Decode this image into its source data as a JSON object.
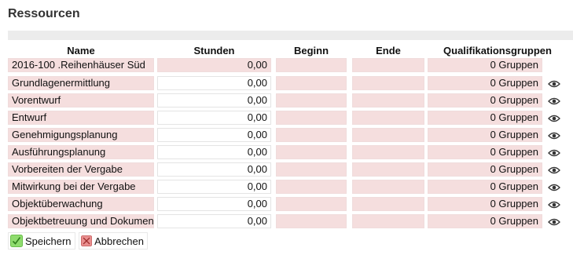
{
  "page": {
    "title": "Ressourcen"
  },
  "columns": {
    "name": "Name",
    "stunden": "Stunden",
    "beginn": "Beginn",
    "ende": "Ende",
    "qual": "Qualifikationsgruppen"
  },
  "rows": [
    {
      "name": "2016-100 .Reihenhäuser Süd",
      "stunden": "0,00",
      "beginn": "",
      "ende": "",
      "qual": "0 Gruppen",
      "hours_editable": false,
      "has_eye": false
    },
    {
      "name": "Grundlagenermittlung",
      "stunden": "0,00",
      "beginn": "",
      "ende": "",
      "qual": "0 Gruppen",
      "hours_editable": true,
      "has_eye": true
    },
    {
      "name": "Vorentwurf",
      "stunden": "0,00",
      "beginn": "",
      "ende": "",
      "qual": "0 Gruppen",
      "hours_editable": true,
      "has_eye": true
    },
    {
      "name": "Entwurf",
      "stunden": "0,00",
      "beginn": "",
      "ende": "",
      "qual": "0 Gruppen",
      "hours_editable": true,
      "has_eye": true
    },
    {
      "name": "Genehmigungsplanung",
      "stunden": "0,00",
      "beginn": "",
      "ende": "",
      "qual": "0 Gruppen",
      "hours_editable": true,
      "has_eye": true
    },
    {
      "name": "Ausführungsplanung",
      "stunden": "0,00",
      "beginn": "",
      "ende": "",
      "qual": "0 Gruppen",
      "hours_editable": true,
      "has_eye": true
    },
    {
      "name": "Vorbereiten der Vergabe",
      "stunden": "0,00",
      "beginn": "",
      "ende": "",
      "qual": "0 Gruppen",
      "hours_editable": true,
      "has_eye": true
    },
    {
      "name": "Mitwirkung bei der Vergabe",
      "stunden": "0,00",
      "beginn": "",
      "ende": "",
      "qual": "0 Gruppen",
      "hours_editable": true,
      "has_eye": true
    },
    {
      "name": "Objektüberwachung",
      "stunden": "0,00",
      "beginn": "",
      "ende": "",
      "qual": "0 Gruppen",
      "hours_editable": true,
      "has_eye": true
    },
    {
      "name": "Objektbetreuung und Dokumentation",
      "stunden": "0,00",
      "beginn": "",
      "ende": "",
      "qual": "0 Gruppen",
      "hours_editable": true,
      "has_eye": true
    }
  ],
  "buttons": {
    "save": "Speichern",
    "cancel": "Abbrechen"
  },
  "icons": {
    "row_action": "eye-icon",
    "save": "check-icon",
    "cancel": "x-icon"
  },
  "colors": {
    "cell_bg": "#f5dede",
    "save_icon": "#8fdc6e",
    "cancel_icon": "#e98f8f"
  }
}
